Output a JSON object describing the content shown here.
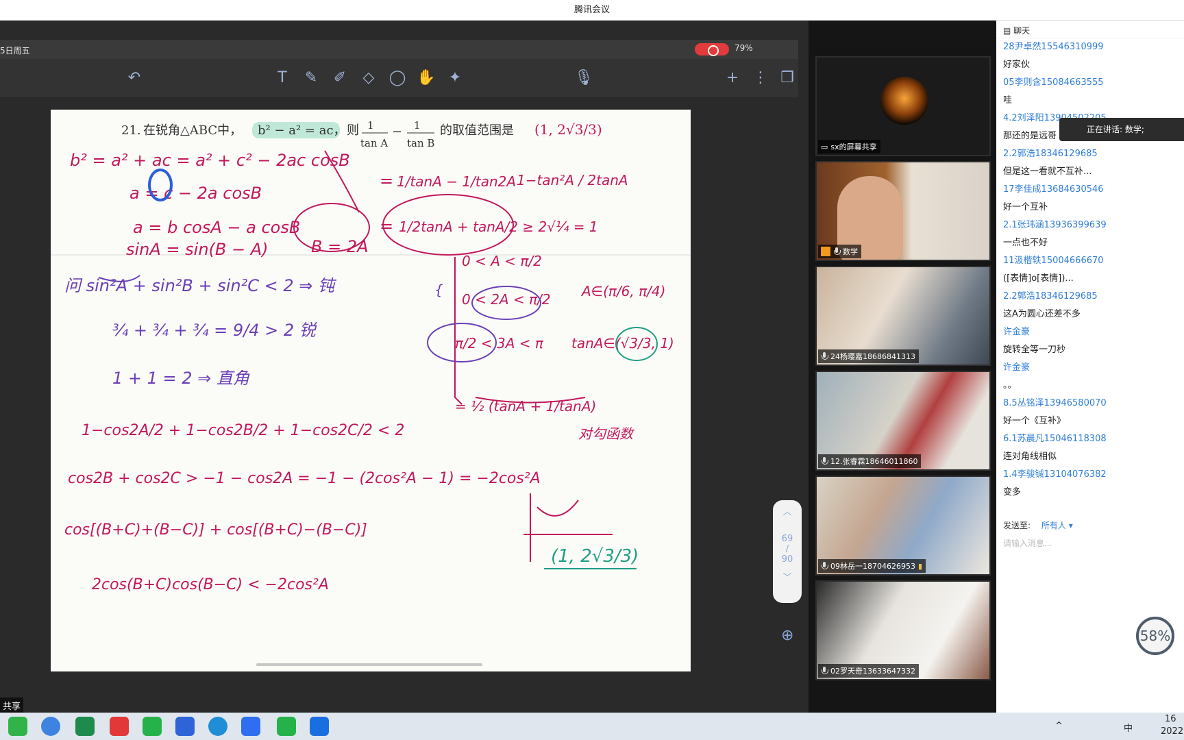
{
  "window": {
    "title": "腾讯会议"
  },
  "ipad": {
    "date": "5日周五",
    "battery": "79%"
  },
  "board": {
    "problem_num": "21.",
    "problem_text": "在锐角△ABC中，",
    "condition": "b² − a² = ac，",
    "then": "则",
    "ask": "的取值范围是",
    "answer": "(1, 2√3/3)",
    "page_current": "69",
    "page_total": "90"
  },
  "participants": [
    {
      "name": "sx的屏幕共享",
      "kind": "share"
    },
    {
      "name": "数学",
      "kind": "host"
    },
    {
      "name": "24杨璎嘉18686841313"
    },
    {
      "name": "12.张睿霖18646011860"
    },
    {
      "name": "09林岳一18704626953"
    },
    {
      "name": "02罗天奇13633647332"
    }
  ],
  "chat": {
    "header": "聊天",
    "speaking": "正在讲话: 数学;",
    "messages": [
      {
        "t": "name",
        "v": "28尹卓然15546310999"
      },
      {
        "t": "text",
        "v": "好家伙"
      },
      {
        "t": "name",
        "v": "05李则含15084663555"
      },
      {
        "t": "text",
        "v": "哇"
      },
      {
        "t": "name",
        "v": "4.2刘泽阳13904502205"
      },
      {
        "t": "text",
        "v": "那还的是远哥"
      },
      {
        "t": "name",
        "v": "2.2郭浩18346129685"
      },
      {
        "t": "text",
        "v": "但是这一看就不互补..."
      },
      {
        "t": "name",
        "v": "17李佳成13684630546"
      },
      {
        "t": "text",
        "v": "好一个互补"
      },
      {
        "t": "name",
        "v": "2.1张玮涵13936399639"
      },
      {
        "t": "text",
        "v": "一点也不好"
      },
      {
        "t": "name",
        "v": "11汲楷轶15004666670"
      },
      {
        "t": "text",
        "v": "([表情]o[表情])..."
      },
      {
        "t": "name",
        "v": "2.2郭浩18346129685"
      },
      {
        "t": "text",
        "v": "这A为圆心还差不多"
      },
      {
        "t": "name",
        "v": "许金豪"
      },
      {
        "t": "text",
        "v": "旋转全等一刀秒"
      },
      {
        "t": "name",
        "v": "许金豪"
      },
      {
        "t": "text",
        "v": "。。"
      },
      {
        "t": "name",
        "v": "8.5丛铭泽13946580070"
      },
      {
        "t": "text",
        "v": "好一个《互补》"
      },
      {
        "t": "name",
        "v": "6.1苏晨凡15046118308"
      },
      {
        "t": "text",
        "v": "连对角线相似"
      },
      {
        "t": "name",
        "v": "1.4李骏铖13104076382"
      },
      {
        "t": "text",
        "v": "变多"
      }
    ],
    "send_to_label": "发送至:",
    "send_to_value": "所有人",
    "input_placeholder": "请输入消息..."
  },
  "share_label": "共享",
  "net_meter": "58%",
  "tray": {
    "ime": "中",
    "time": "16",
    "date": "2022"
  }
}
